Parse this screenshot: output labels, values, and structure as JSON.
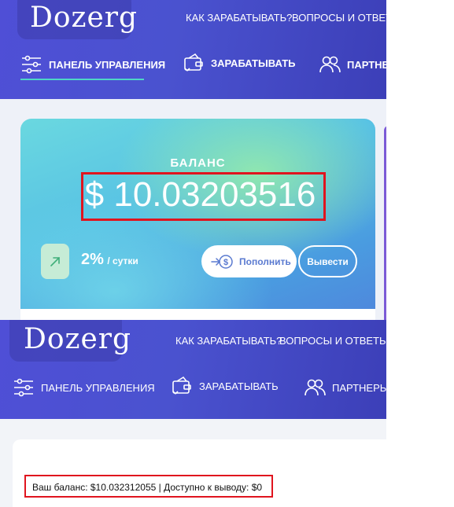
{
  "shot1": {
    "logo": "Dozerg",
    "top_nav": [
      "КАК ЗАРАБАТЫВАТЬ?",
      "ВОПРОСЫ И ОТВЕТЫ"
    ],
    "tabs": [
      {
        "label": "ПАНЕЛЬ УПРАВЛЕНИЯ",
        "icon": "sliders-icon",
        "active": true
      },
      {
        "label": "ЗАРАБАТЫВАТЬ",
        "icon": "wallet-icon",
        "active": false
      },
      {
        "label": "ПАРТНЕРЫ",
        "icon": "users-icon",
        "active": false
      }
    ],
    "balance_label": "БАЛАНС",
    "balance_value": "$ 10.03203516",
    "rate_percent": "2%",
    "rate_unit": "/ сутки",
    "rate_icon": "arrow-up-right-icon",
    "deposit_label": "Пополнить",
    "deposit_icon": "coin-in-icon",
    "withdraw_label": "Вывести"
  },
  "shot2": {
    "logo": "Dozerg",
    "top_nav": [
      "КАК ЗАРАБАТЫВАТЬ?",
      "ВОПРОСЫ И ОТВЕТЫ"
    ],
    "tabs": [
      {
        "label": "ПАНЕЛЬ УПРАВЛЕНИЯ",
        "icon": "sliders-icon"
      },
      {
        "label": "ЗАРАБАТЫВАТЬ",
        "icon": "wallet-icon"
      },
      {
        "label": "ПАРТНЕРЫ",
        "icon": "users-icon"
      }
    ],
    "balance_text": "Ваш баланс: $10.032312055 | Доступно к выводу: $0"
  },
  "colors": {
    "header": "#4a52cf",
    "accent_underline": "#4ed6c6",
    "highlight_box": "#e0141e",
    "button_text": "#5a7ad0"
  }
}
